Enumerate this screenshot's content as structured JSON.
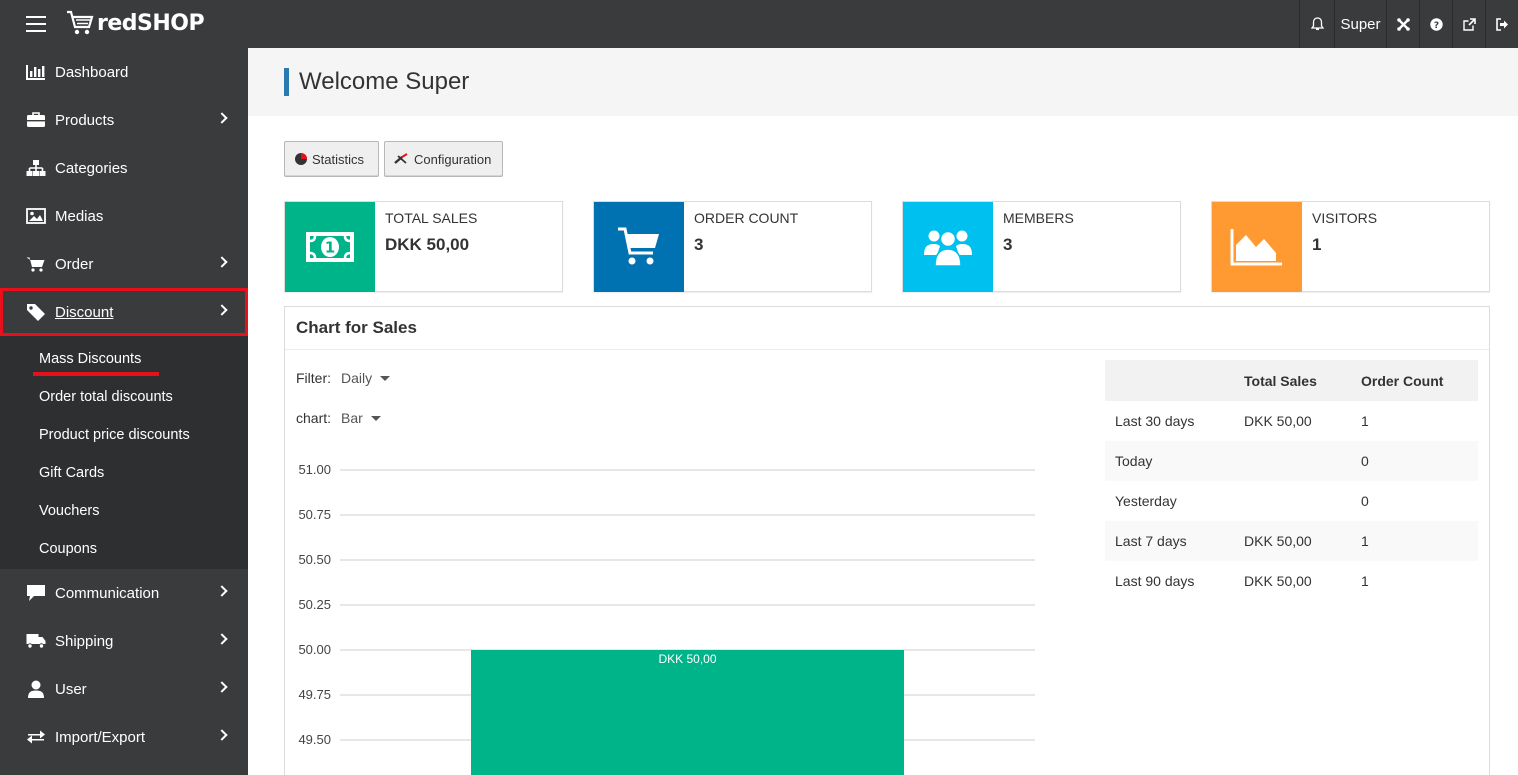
{
  "app": {
    "logo_text": "redSHOP",
    "colors": {
      "dark": "#3a3b3d",
      "accent_red": "#e8101a",
      "teal": "#00b48a",
      "blue": "#0072b1",
      "cyan": "#00c0ef",
      "orange": "#ff9a33"
    }
  },
  "topnav": {
    "bell_icon": "bell-icon",
    "user_label": "Super",
    "icons": [
      "joomla-icon",
      "help-icon",
      "external-link-icon",
      "logout-icon"
    ]
  },
  "sidebar": {
    "items": [
      {
        "label": "Dashboard",
        "icon": "bar-chart-icon",
        "has_children": false
      },
      {
        "label": "Products",
        "icon": "briefcase-icon",
        "has_children": true
      },
      {
        "label": "Categories",
        "icon": "sitemap-icon",
        "has_children": false
      },
      {
        "label": "Medias",
        "icon": "image-icon",
        "has_children": false
      },
      {
        "label": "Order",
        "icon": "cart-icon",
        "has_children": true
      },
      {
        "label": "Discount",
        "icon": "tag-icon",
        "has_children": true,
        "active": true
      },
      {
        "label": "Communication",
        "icon": "comment-icon",
        "has_children": true
      },
      {
        "label": "Shipping",
        "icon": "truck-icon",
        "has_children": true
      },
      {
        "label": "User",
        "icon": "user-icon",
        "has_children": true
      },
      {
        "label": "Import/Export",
        "icon": "exchange-icon",
        "has_children": true
      }
    ],
    "discount_submenu": [
      "Mass Discounts",
      "Order total discounts",
      "Product price discounts",
      "Gift Cards",
      "Vouchers",
      "Coupons"
    ]
  },
  "header": {
    "title": "Welcome Super"
  },
  "toolbar": {
    "statistics_label": "Statistics",
    "configuration_label": "Configuration"
  },
  "stats": [
    {
      "label": "TOTAL SALES",
      "value": "DKK 50,00",
      "icon": "money-icon",
      "color": "#00b48a"
    },
    {
      "label": "ORDER COUNT",
      "value": "3",
      "icon": "cart-icon",
      "color": "#0072b1"
    },
    {
      "label": "MEMBERS",
      "value": "3",
      "icon": "users-icon",
      "color": "#00c0ef"
    },
    {
      "label": "VISITORS",
      "value": "1",
      "icon": "area-chart-icon",
      "color": "#ff9a33"
    }
  ],
  "chart_panel": {
    "title": "Chart for Sales",
    "filter_label": "Filter:",
    "filter_value": "Daily",
    "chart_label": "chart:",
    "chart_value": "Bar"
  },
  "chart_data": {
    "type": "bar",
    "categories": [
      ""
    ],
    "values": [
      50.0
    ],
    "data_labels": [
      "DKK 50,00"
    ],
    "y_ticks": [
      "51.00",
      "50.75",
      "50.50",
      "50.25",
      "50.00",
      "49.75",
      "49.50"
    ],
    "ylim": [
      49.25,
      51.0
    ],
    "grid": true,
    "bar_color": "#00b48a"
  },
  "summary_table": {
    "headers": [
      "",
      "Total Sales",
      "Order Count"
    ],
    "rows": [
      [
        "Last 30 days",
        "DKK 50,00",
        "1"
      ],
      [
        "Today",
        "",
        "0"
      ],
      [
        "Yesterday",
        "",
        "0"
      ],
      [
        "Last 7 days",
        "DKK 50,00",
        "1"
      ],
      [
        "Last 90 days",
        "DKK 50,00",
        "1"
      ]
    ]
  }
}
